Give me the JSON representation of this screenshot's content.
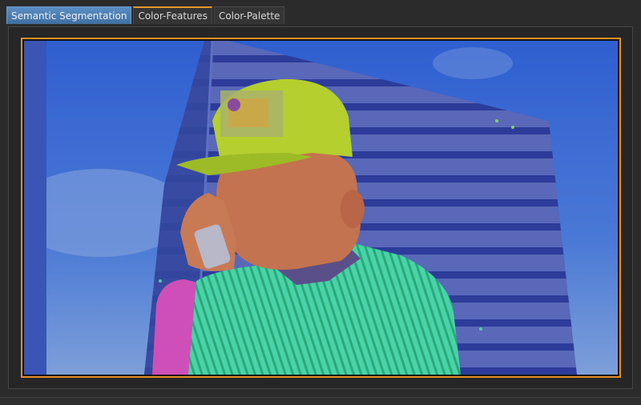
{
  "tabs": [
    {
      "label": "Semantic Segmentation",
      "active": true
    },
    {
      "label": "Color-Features",
      "active": false
    },
    {
      "label": "Color-Palette",
      "active": false
    }
  ],
  "viewer": {
    "frame_color": "#e2902a",
    "segment_colors": {
      "sky": "#3f6fd3",
      "building": "#4a5fb8",
      "person_skin": "#b8664a",
      "shirt": "#39c99a",
      "cap": "#b4cf2e",
      "arm": "#cf4fb8"
    }
  }
}
